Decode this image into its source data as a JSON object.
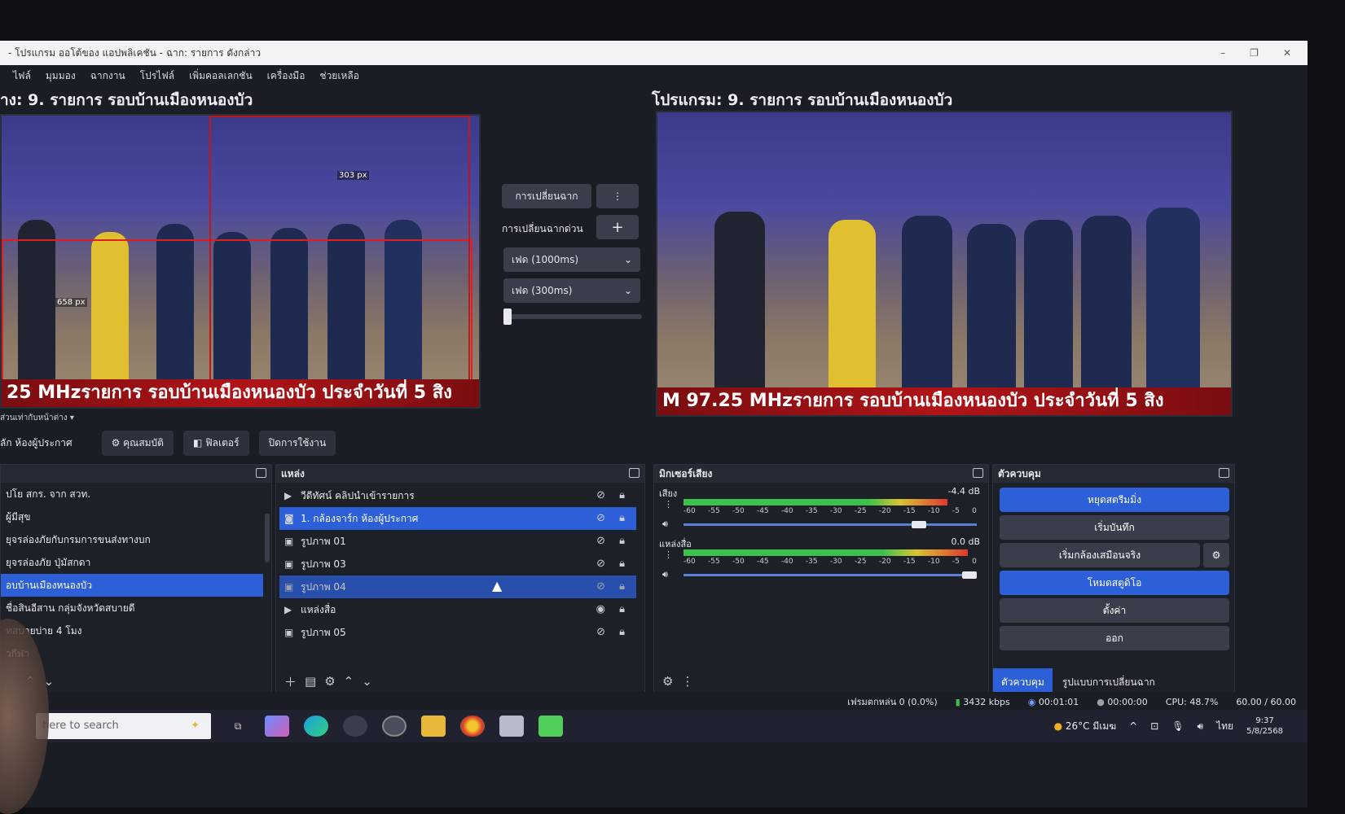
{
  "window": {
    "title": "- โปรแกรม ออโต้ของ แอปพลิเคชัน - ฉาก: รายการ ดังกล่าว"
  },
  "menu": [
    "ไฟล์",
    "มุมมอง",
    "ฉากงาน",
    "โปรไฟล์",
    "เพิ่มคอลเลกชัน",
    "เครื่องมือ",
    "ช่วยเหลือ"
  ],
  "preview_left": {
    "title": "าง: 9.  รายการ รอบบ้านเมืองหนองบัว",
    "ticker": "25 MHzรายการ รอบบ้านเมืองหนองบัว ประจำวันที่ 5 สิง",
    "dim_top": "303 px",
    "dim_left": "658 px"
  },
  "preview_right": {
    "title": "โปรแกรม: 9.  รายการ รอบบ้านเมืองหนองบัว",
    "ticker": "M 97.25 MHzรายการ รอบบ้านเมืองหนองบัว ประจำวันที่ 5 สิง"
  },
  "transition": {
    "button": "การเปลี่ยนฉาก",
    "quick_label": "การเปลี่ยนฉากด่วน",
    "fade_select": "เฟด (1000ms)",
    "cut_select": "เฟด (300ms)"
  },
  "toolbar": {
    "dropdown": "ส่วนเท่ากับหน้าต่าง",
    "scene_name": "ลัก ห้องผู้ประกาศ",
    "properties": "คุณสมบัติ",
    "filters": "ฟิลเตอร์",
    "disable": "ปิดการใช้งาน"
  },
  "scenes_dock": {
    "items": [
      "ปโย สกร. จาก สวท.",
      "ผู้มีสุข",
      "ยุจรล่องภัยกับกรมการขนส่งทางบก",
      "ยุจรล่องภัย ปุ่มัสกดา",
      "อบบ้านเมืองหนองบัว",
      "ชื่อสินอีสาน กลุ่มจังหวัดสบายดี",
      "ทสบายบ่าย 4 โมง",
      "วกีฬา"
    ],
    "active_index": 4
  },
  "sources_dock": {
    "title": "แหล่ง",
    "items": [
      {
        "icon": "play",
        "label": "วีดีทัศน์ คลิปนำเข้ารายการ"
      },
      {
        "icon": "camera",
        "label": "1. กล้องจาร์ก ห้องผู้ประกาศ"
      },
      {
        "icon": "image",
        "label": "รูปภาพ 01"
      },
      {
        "icon": "image",
        "label": "รูปภาพ 03"
      },
      {
        "icon": "image",
        "label": "รูปภาพ 04"
      },
      {
        "icon": "play",
        "label": "แหล่งสื่อ"
      },
      {
        "icon": "image",
        "label": "รูปภาพ 05"
      }
    ]
  },
  "mixer": {
    "title": "มิกเซอร์เสียง",
    "channels": [
      {
        "name": "เสียง",
        "db": "-4.4 dB",
        "level": 0.9,
        "volume": 0.82
      },
      {
        "name": "แหล่งสื่อ",
        "db": "0.0 dB",
        "level": 0.97,
        "volume": 1.0
      }
    ],
    "ticks": [
      "-60",
      "-55",
      "-50",
      "-45",
      "-40",
      "-35",
      "-30",
      "-25",
      "-20",
      "-15",
      "-10",
      "-5",
      "0"
    ]
  },
  "controls": {
    "title": "ตัวควบคุม",
    "stop_stream": "หยุดสตรีมมิ่ง",
    "record": "เริ่มบันทึก",
    "virtual_cam": "เริ่มกล้องเสมือนจริง",
    "studio_mode": "โหมดสตูดิโอ",
    "settings": "ตั้งค่า",
    "exit": "ออก",
    "tab_controls": "ตัวควบคุม",
    "tab_transitions": "รูปแบบการเปลี่ยนฉาก"
  },
  "status": {
    "dropped": "เฟรมตกหล่น 0 (0.0%)",
    "bitrate": "3432 kbps",
    "live_time": "00:01:01",
    "rec_time": "00:00:00",
    "cpu": "CPU: 48.7%",
    "fps": "60.00 / 60.00"
  },
  "taskbar": {
    "search_placeholder": "here to search",
    "weather": "26°C มีเมฆ",
    "lang": "ไทย",
    "time": "9:37",
    "date": "5/8/2568"
  },
  "colors": {
    "accent_blue": "#2c5fd8",
    "ticker_red": "#b01418",
    "panel_bg": "#1e2028"
  }
}
